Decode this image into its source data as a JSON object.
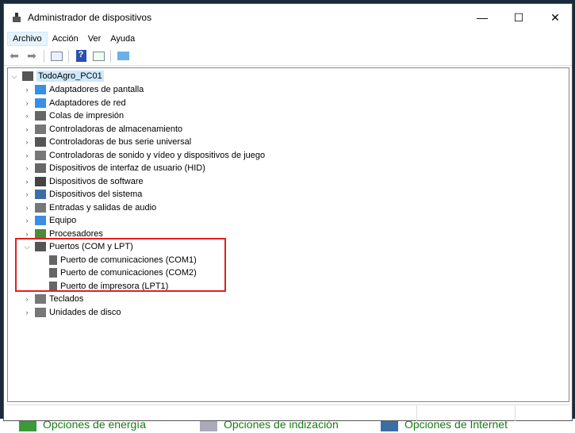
{
  "window": {
    "title": "Administrador de dispositivos",
    "minimize": "—",
    "maximize": "☐",
    "close": "✕"
  },
  "menu": [
    "Archivo",
    "Acción",
    "Ver",
    "Ayuda"
  ],
  "toolbar": [
    "back-icon",
    "forward-icon",
    "properties-icon",
    "help-icon",
    "update-driver-icon",
    "scan-hardware-icon"
  ],
  "tree": {
    "root": "TodoAgro_PC01",
    "items": [
      {
        "label": "Adaptadores de pantalla",
        "icon": "display-adapter-icon",
        "color": "#3a8ee6"
      },
      {
        "label": "Adaptadores de red",
        "icon": "network-adapter-icon",
        "color": "#3a8ee6"
      },
      {
        "label": "Colas de impresión",
        "icon": "printer-icon",
        "color": "#666666"
      },
      {
        "label": "Controladoras de almacenamiento",
        "icon": "storage-controller-icon",
        "color": "#777777"
      },
      {
        "label": "Controladoras de bus serie universal",
        "icon": "usb-icon",
        "color": "#555555"
      },
      {
        "label": "Controladoras de sonido y vídeo y dispositivos de juego",
        "icon": "speaker-icon",
        "color": "#777777"
      },
      {
        "label": "Dispositivos de interfaz de usuario (HID)",
        "icon": "hid-icon",
        "color": "#666666"
      },
      {
        "label": "Dispositivos de software",
        "icon": "software-device-icon",
        "color": "#444444"
      },
      {
        "label": "Dispositivos del sistema",
        "icon": "system-device-icon",
        "color": "#3a6ea5"
      },
      {
        "label": "Entradas y salidas de audio",
        "icon": "audio-icon",
        "color": "#777777"
      },
      {
        "label": "Equipo",
        "icon": "computer-icon",
        "color": "#3a8ee6"
      },
      {
        "label": "Procesadores",
        "icon": "processor-icon",
        "color": "#4a8a3a"
      },
      {
        "label": "Puertos (COM y LPT)",
        "icon": "port-icon",
        "color": "#555555",
        "expanded": true,
        "children": [
          "Puerto de comunicaciones (COM1)",
          "Puerto de comunicaciones (COM2)",
          "Puerto de impresora (LPT1)"
        ]
      },
      {
        "label": "Teclados",
        "icon": "keyboard-icon",
        "color": "#777777"
      },
      {
        "label": "Unidades de disco",
        "icon": "disk-icon",
        "color": "#777777"
      }
    ]
  },
  "background": [
    "Opciones de energía",
    "Opciones de indización",
    "Opciones de Internet"
  ],
  "colors": {
    "highlight": "#e02020",
    "selection": "#cce8ff",
    "bg_link": "#1a7a1a"
  }
}
